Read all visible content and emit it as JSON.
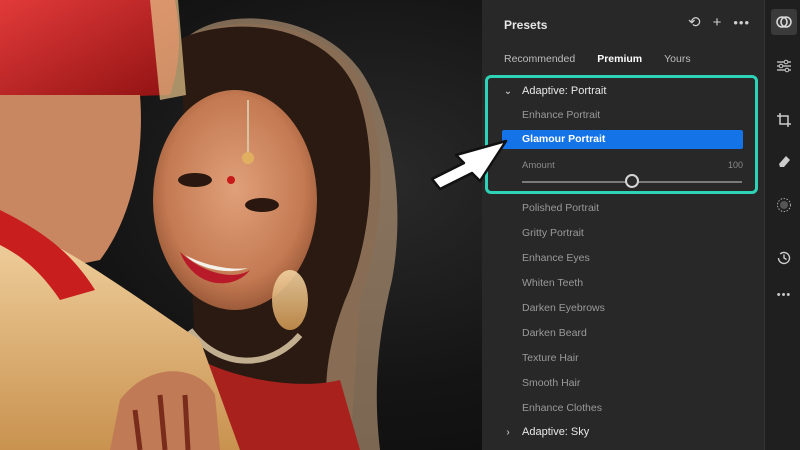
{
  "presets_panel": {
    "title": "Presets",
    "header_icons": [
      "undo-icon",
      "plus-icon",
      "more-icon"
    ],
    "tabs": [
      {
        "label": "Recommended",
        "active": false
      },
      {
        "label": "Premium",
        "active": true
      },
      {
        "label": "Yours",
        "active": false
      }
    ],
    "group_open": {
      "label": "Adaptive: Portrait",
      "expanded": true
    },
    "presets": [
      {
        "label": "Enhance Portrait",
        "selected": false
      },
      {
        "label": "Glamour Portrait",
        "selected": true
      },
      {
        "label": "Polished Portrait",
        "selected": false
      },
      {
        "label": "Gritty Portrait",
        "selected": false
      },
      {
        "label": "Enhance Eyes",
        "selected": false
      },
      {
        "label": "Whiten Teeth",
        "selected": false
      },
      {
        "label": "Darken Eyebrows",
        "selected": false
      },
      {
        "label": "Darken Beard",
        "selected": false
      },
      {
        "label": "Texture Hair",
        "selected": false
      },
      {
        "label": "Smooth Hair",
        "selected": false
      },
      {
        "label": "Enhance Clothes",
        "selected": false
      }
    ],
    "amount": {
      "label": "Amount",
      "value": "100",
      "slider_fraction": 0.5
    },
    "group_closed": {
      "label": "Adaptive: Sky",
      "expanded": false
    }
  },
  "toolstrip": [
    "presets-icon",
    "edit-sliders-icon",
    "crop-icon",
    "eraser-icon",
    "masking-icon",
    "history-icon",
    "more-icon"
  ],
  "colors": {
    "accent_selected": "#1473e6",
    "highlight_box": "#2ed3b7",
    "panel_bg": "#282828"
  }
}
